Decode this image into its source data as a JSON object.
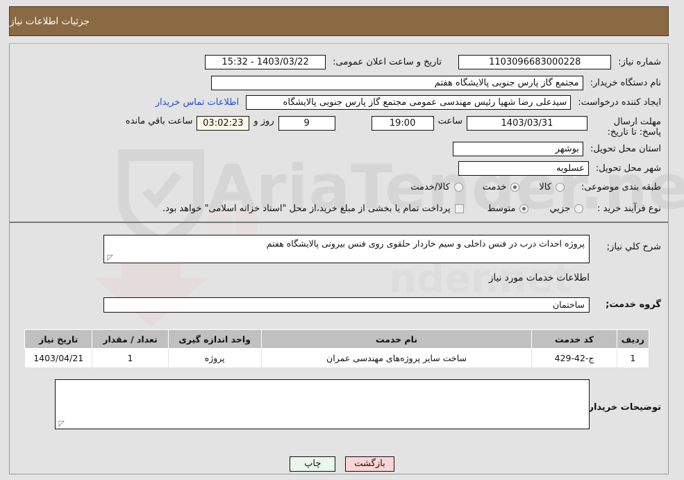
{
  "header": {
    "title": "جزئیات اطلاعات نیاز"
  },
  "form": {
    "need_number_label": "شماره نیاز:",
    "need_number_value": "1103096683000228",
    "public_announce_label": "تاریخ و ساعت اعلان عمومی:",
    "public_announce_value": "1403/03/22 - 15:32",
    "buyer_org_label": "نام دستگاه خریدار:",
    "buyer_org_value": "مجتمع گاز پارس جنوبی  پالایشگاه هفتم",
    "requester_label": "ایجاد کننده درخواست:",
    "requester_value": "سیدعلی رضا شهپا رئیس مهندسی عمومی مجتمع گاز پارس جنوبی  پالایشگاه",
    "buyer_contact_link": "اطلاعات تماس خریدار",
    "deadline_label": "مهلت ارسال پاسخ: تا تاریخ:",
    "deadline_date": "1403/03/31",
    "deadline_time_label": "ساعت",
    "deadline_time": "19:00",
    "remaining_days": "9",
    "remaining_days_label": "روز و",
    "remaining_clock": "03:02:23",
    "remaining_clock_label": "ساعت باقي مانده",
    "province_label": "استان محل تحویل:",
    "province_value": "بوشهر",
    "city_label": "شهر محل تحویل:",
    "city_value": "عسلویه",
    "category_label": "طبقه بندی موضوعی:",
    "category_options": [
      {
        "label": "کالا",
        "selected": false
      },
      {
        "label": "خدمت",
        "selected": true
      },
      {
        "label": "کالا/خدمت",
        "selected": false
      }
    ],
    "process_label": "نوع فرآیند خرید :",
    "process_options": [
      {
        "label": "جزیي",
        "selected": false
      },
      {
        "label": "متوسط",
        "selected": true
      }
    ],
    "treasury_checkbox_label": "پرداخت تمام یا بخشی از مبلغ خرید،از محل \"اسناد خزانه اسلامی\" خواهد بود.",
    "treasury_checked": false
  },
  "details": {
    "summary_label": "شرح کلي نیاز;",
    "summary_value": "پروژه احداث درب در فنس داخلی و سیم خاردار حلقوی روی فنس بیرونی پالایشگاه هفتم",
    "services_info_title": "اطلاعات خدمات مورد نیاز",
    "service_group_label": "گروه خدمت;",
    "service_group_value": "ساختمان",
    "buyer_notes_label": "توضیحات خریدار;",
    "buyer_notes_value": ""
  },
  "table": {
    "columns": [
      "ردیف",
      "کد خدمت",
      "نام خدمت",
      "واحد اندازه گیری",
      "تعداد / مقدار",
      "تاریخ نیاز"
    ],
    "rows": [
      {
        "row_no": "1",
        "service_code": "ج-42-429",
        "service_name": "ساخت سایر پروژه‌های مهندسی عمران",
        "unit": "پروژه",
        "quantity": "1",
        "need_date": "1403/04/21"
      }
    ]
  },
  "footer": {
    "print_label": "چاپ",
    "back_label": "بازگشت"
  },
  "colors": {
    "header_bg": "#8a6a43",
    "page_bg": "#e3e3e3",
    "link": "#1b4fd8",
    "table_header_bg": "#c0c0c0",
    "print_btn_bg": "#eaf7ea",
    "back_btn_bg": "#fbd4d4",
    "countdown_bg": "#fdfbe8"
  }
}
